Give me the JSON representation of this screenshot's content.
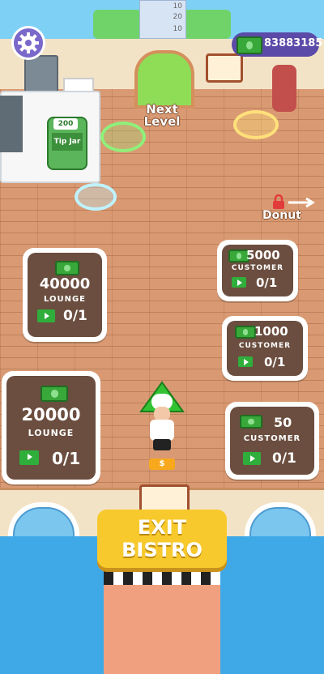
{
  "hud": {
    "settings_icon": "gear-icon",
    "money_icon": "cash-icon",
    "money_value": "83883185"
  },
  "top_counter": {
    "values": [
      "10",
      "20",
      "10"
    ]
  },
  "next_level": {
    "label_line1": "Next",
    "label_line2": "Level"
  },
  "tip_jar": {
    "amount": "200",
    "label": "Tip Jar"
  },
  "donut_door": {
    "label": "Donut",
    "lock_icon": "lock-icon",
    "arrow_icon": "arrow-right-icon"
  },
  "upgrade_pads": [
    {
      "price": "40000",
      "type": "LOUNGE",
      "progress": "0/1"
    },
    {
      "price": "5000",
      "type": "CUSTOMER",
      "progress": "0/1"
    },
    {
      "price": "1000",
      "type": "CUSTOMER",
      "progress": "0/1"
    },
    {
      "price": "20000",
      "type": "LOUNGE",
      "progress": "0/1"
    },
    {
      "price": "50",
      "type": "CUSTOMER",
      "progress": "0/1"
    }
  ],
  "player_coin": "$",
  "exit_button": {
    "line1": "EXIT",
    "line2": "BISTRO"
  },
  "colors": {
    "pad_dark": "#6b4e3f",
    "cash_green": "#39a83a",
    "button_yellow": "#f8c92c",
    "floor": "#d99a73"
  }
}
